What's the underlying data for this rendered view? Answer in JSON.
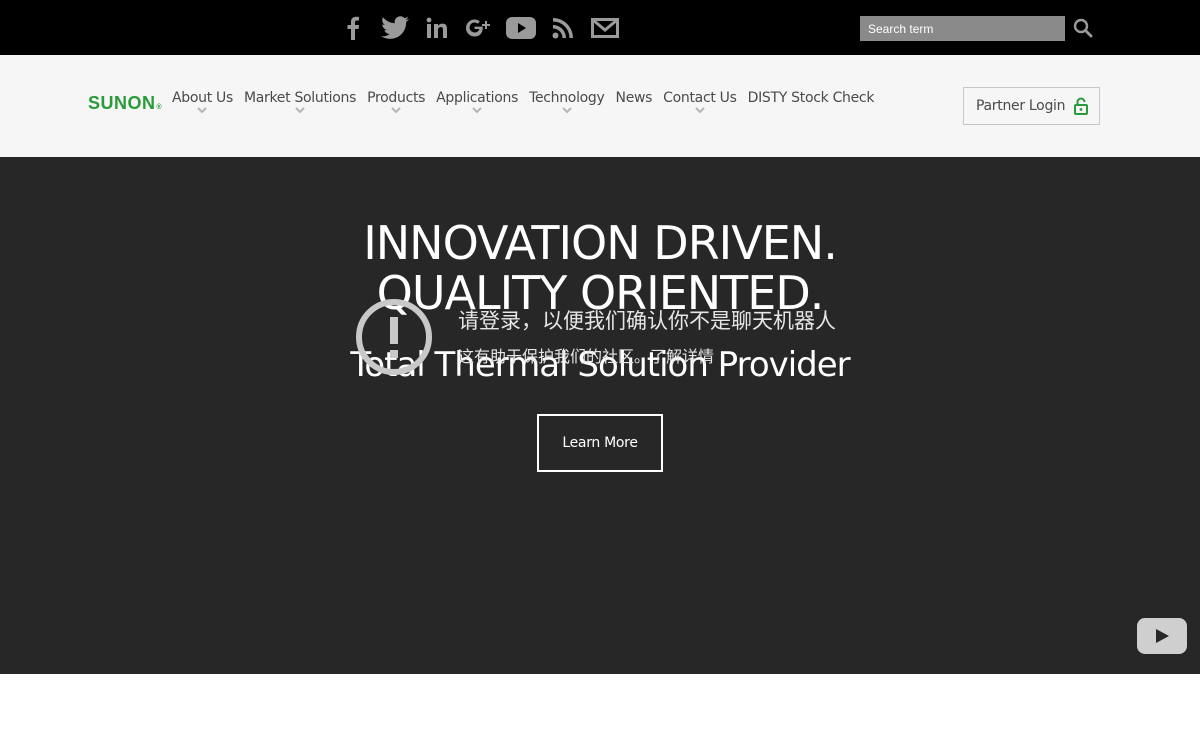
{
  "topbar": {
    "social_icons": [
      "facebook-icon",
      "twitter-icon",
      "linkedin-icon",
      "google-plus-icon",
      "youtube-icon",
      "rss-icon",
      "email-icon"
    ],
    "search": {
      "placeholder": "Search term",
      "value": ""
    }
  },
  "header": {
    "logo_text": "SUNON",
    "logo_mark": "®",
    "nav": [
      {
        "label": "About Us",
        "has_dropdown": true
      },
      {
        "label": "Market Solutions",
        "has_dropdown": true
      },
      {
        "label": "Products",
        "has_dropdown": true
      },
      {
        "label": "Applications",
        "has_dropdown": true
      },
      {
        "label": "Technology",
        "has_dropdown": true
      },
      {
        "label": "News",
        "has_dropdown": false
      },
      {
        "label": "Contact Us",
        "has_dropdown": true
      },
      {
        "label": "DISTY Stock Check",
        "has_dropdown": false
      }
    ],
    "partner_login": "Partner Login"
  },
  "hero": {
    "title_line1": "INNOVATION DRIVEN.",
    "title_line2": "QUALITY ORIENTED.",
    "subtitle": "Total Thermal Solution Provider",
    "cta": "Learn More"
  },
  "notice": {
    "line1": "请登录，以便我们确认你不是聊天机器人",
    "line2_prefix": "这有助于保护我们的社区。",
    "line2_link": "了解详情"
  },
  "colors": {
    "brand_green": "#2a9a3a",
    "topbar_bg": "#000000",
    "header_bg": "#f6f6f6",
    "hero_bg": "#272727",
    "icon_gray": "#9a9a9a"
  }
}
